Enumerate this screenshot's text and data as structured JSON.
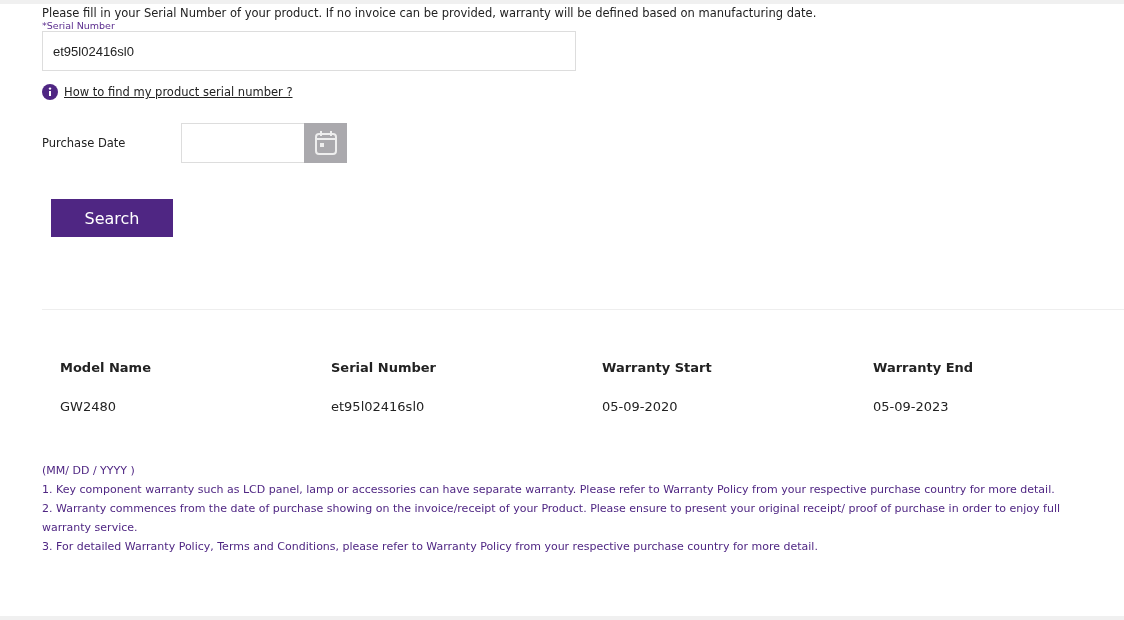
{
  "intro": "Please fill in your Serial Number of your product. If no invoice can be provided, warranty will be defined based on manufacturing date.",
  "serial_field": {
    "label": "*Serial Number",
    "value": "et95l02416sl0"
  },
  "help_link": "How to find my product serial number ?",
  "purchase_date": {
    "label": "Purchase Date"
  },
  "search_button": "Search",
  "table": {
    "columns": [
      "Model Name",
      "Serial Number",
      "Warranty Start",
      "Warranty End"
    ],
    "rows": [
      [
        "GW2480",
        "et95l02416sl0",
        "05-09-2020",
        "05-09-2023"
      ]
    ]
  },
  "notes": [
    "(MM/ DD  / YYYY )",
    "1. Key component warranty such as LCD panel, lamp or accessories can have separate warranty. Please refer to Warranty Policy from your respective purchase country for more detail.",
    "2. Warranty commences from the date of purchase showing on the invoice/receipt of your Product. Please ensure to present your original receipt/ proof of purchase in order to enjoy full warranty service.",
    "3. For detailed Warranty Policy, Terms and Conditions, please refer to Warranty Policy from your respective purchase country for more detail."
  ]
}
